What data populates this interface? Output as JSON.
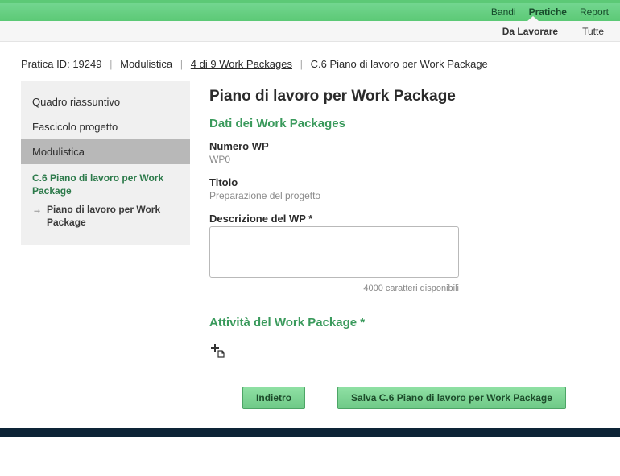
{
  "header": {
    "nav": [
      {
        "label": "Bandi",
        "active": false
      },
      {
        "label": "Pratiche",
        "active": true
      },
      {
        "label": "Report",
        "active": false
      }
    ],
    "subnav": [
      {
        "label": "Da Lavorare",
        "active": true
      },
      {
        "label": "Tutte",
        "active": false
      }
    ]
  },
  "breadcrumb": {
    "pratica_prefix": "Pratica ID:",
    "pratica_id": "19249",
    "item1": "Modulistica",
    "item2": "4 di 9 Work Packages",
    "item3": "C.6 Piano di lavoro per Work Package"
  },
  "sidebar": {
    "items": [
      {
        "label": "Quadro riassuntivo",
        "selected": false
      },
      {
        "label": "Fascicolo progetto",
        "selected": false
      },
      {
        "label": "Modulistica",
        "selected": true
      }
    ],
    "sub_label": "C.6 Piano di lavoro per Work Package",
    "sub2_label": "Piano di lavoro per Work Package"
  },
  "main": {
    "title": "Piano di lavoro per Work Package",
    "section1": "Dati dei Work Packages",
    "numero_label": "Numero WP",
    "numero_value": "WP0",
    "titolo_label": "Titolo",
    "titolo_value": "Preparazione del progetto",
    "descr_label": "Descrizione del WP *",
    "descr_value": "",
    "char_count": "4000 caratteri disponibili",
    "section2": "Attività del Work Package *",
    "btn_back": "Indietro",
    "btn_save": "Salva C.6 Piano di lavoro per Work Package"
  }
}
